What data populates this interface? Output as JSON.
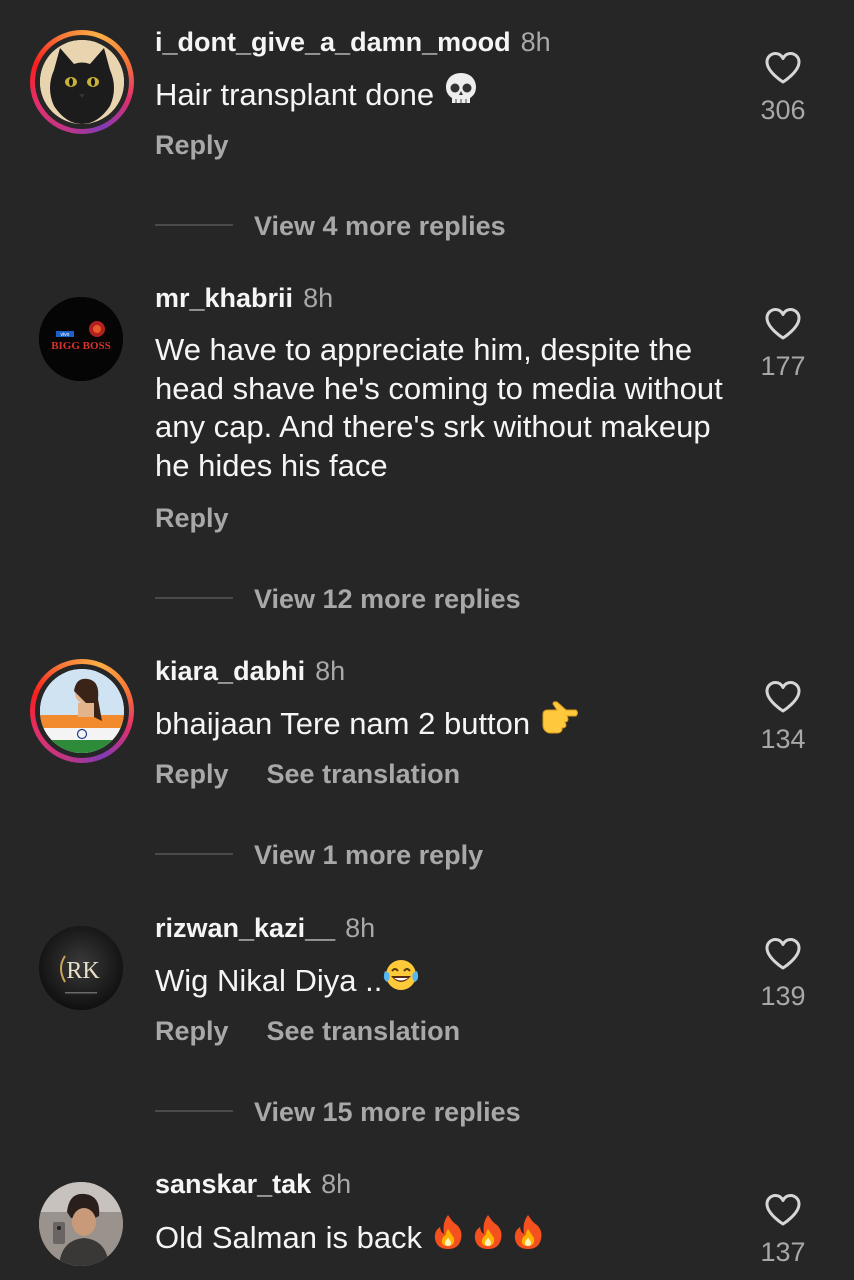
{
  "comments": [
    {
      "username": "i_dont_give_a_damn_mood",
      "time": "8h",
      "text": "Hair transplant done",
      "emojis": [
        "skull-emoji"
      ],
      "reply_label": "Reply",
      "likes": "306",
      "more_replies": "View 4 more replies",
      "avatar": "black-cat-avatar",
      "story_ring": true
    },
    {
      "username": "mr_khabrii",
      "time": "8h",
      "text": "We have to appreciate him, despite the head shave he's coming to media without any cap. And there's srk without makeup he hides his face",
      "emojis": [],
      "reply_label": "Reply",
      "likes": "177",
      "more_replies": "View 12 more replies",
      "avatar": "bigg-boss-logo-avatar",
      "avatar_text": {
        "top": "vivo",
        "main": "BIGG BOSS"
      },
      "story_ring": false
    },
    {
      "username": "kiara_dabhi",
      "time": "8h",
      "text": "bhaijaan Tere nam 2 button",
      "emojis": [
        "pointing-right-emoji"
      ],
      "reply_label": "Reply",
      "translation_label": "See translation",
      "likes": "134",
      "more_replies": "View 1 more reply",
      "avatar": "girl-with-flag-avatar",
      "story_ring": true
    },
    {
      "username": "rizwan_kazi__",
      "time": "8h",
      "text": "Wig Nikal Diya ..",
      "emojis": [
        "tears-of-joy-emoji"
      ],
      "reply_label": "Reply",
      "translation_label": "See translation",
      "likes": "139",
      "more_replies": "View 15 more replies",
      "avatar": "rk-monogram-avatar",
      "avatar_text": "RK",
      "story_ring": false
    },
    {
      "username": "sanskar_tak",
      "time": "8h",
      "text": "Old Salman is back",
      "emojis": [
        "fire-emoji",
        "fire-emoji",
        "fire-emoji"
      ],
      "likes": "137",
      "avatar": "selfie-avatar",
      "story_ring": false
    }
  ],
  "colors": {
    "background": "#262626",
    "primary_text": "#f5f5f5",
    "secondary_text": "#a8a8a8"
  }
}
